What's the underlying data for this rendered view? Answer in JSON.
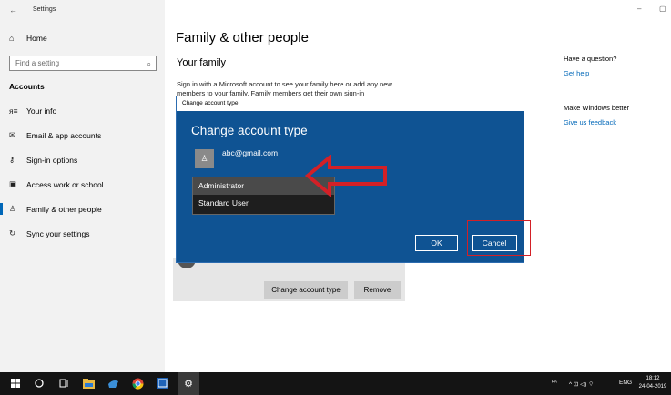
{
  "window": {
    "title": "Settings",
    "back_icon": "←",
    "minimize_icon": "–",
    "maximize_icon": "▢"
  },
  "sidebar": {
    "home_label": "Home",
    "search_placeholder": "Find a setting",
    "section_label": "Accounts",
    "items": [
      {
        "label": "Your info",
        "icon": "person-lines-icon",
        "glyph": "ᴙ≡"
      },
      {
        "label": "Email & app accounts",
        "icon": "mail-icon",
        "glyph": "✉"
      },
      {
        "label": "Sign-in options",
        "icon": "key-icon",
        "glyph": "⚷"
      },
      {
        "label": "Access work or school",
        "icon": "briefcase-icon",
        "glyph": "▣"
      },
      {
        "label": "Family & other people",
        "icon": "person-add-icon",
        "glyph": "♙"
      },
      {
        "label": "Sync your settings",
        "icon": "sync-icon",
        "glyph": "↻"
      }
    ]
  },
  "main": {
    "title": "Family & other people",
    "section_title": "Your family",
    "description": "Sign in with a Microsoft account to see your family here or add any new members to your family. Family members get their own sign-in",
    "change_account_type_label": "Change account type",
    "remove_label": "Remove"
  },
  "right_panel": {
    "question": "Have a question?",
    "get_help": "Get help",
    "better": "Make Windows better",
    "feedback": "Give us feedback"
  },
  "dialog": {
    "title_bar": "Change account type",
    "heading": "Change account type",
    "email": "abc@gmail.com",
    "options": [
      "Administrator",
      "Standard User"
    ],
    "ok_label": "OK",
    "cancel_label": "Cancel",
    "annotation_color": "#d32027"
  },
  "taskbar": {
    "tray_people": "ᴿᴬ",
    "tray_icons": "^ ⊡ ◁) ⌔",
    "language": "ENG",
    "time": "18:12",
    "date": "24-04-2019"
  }
}
